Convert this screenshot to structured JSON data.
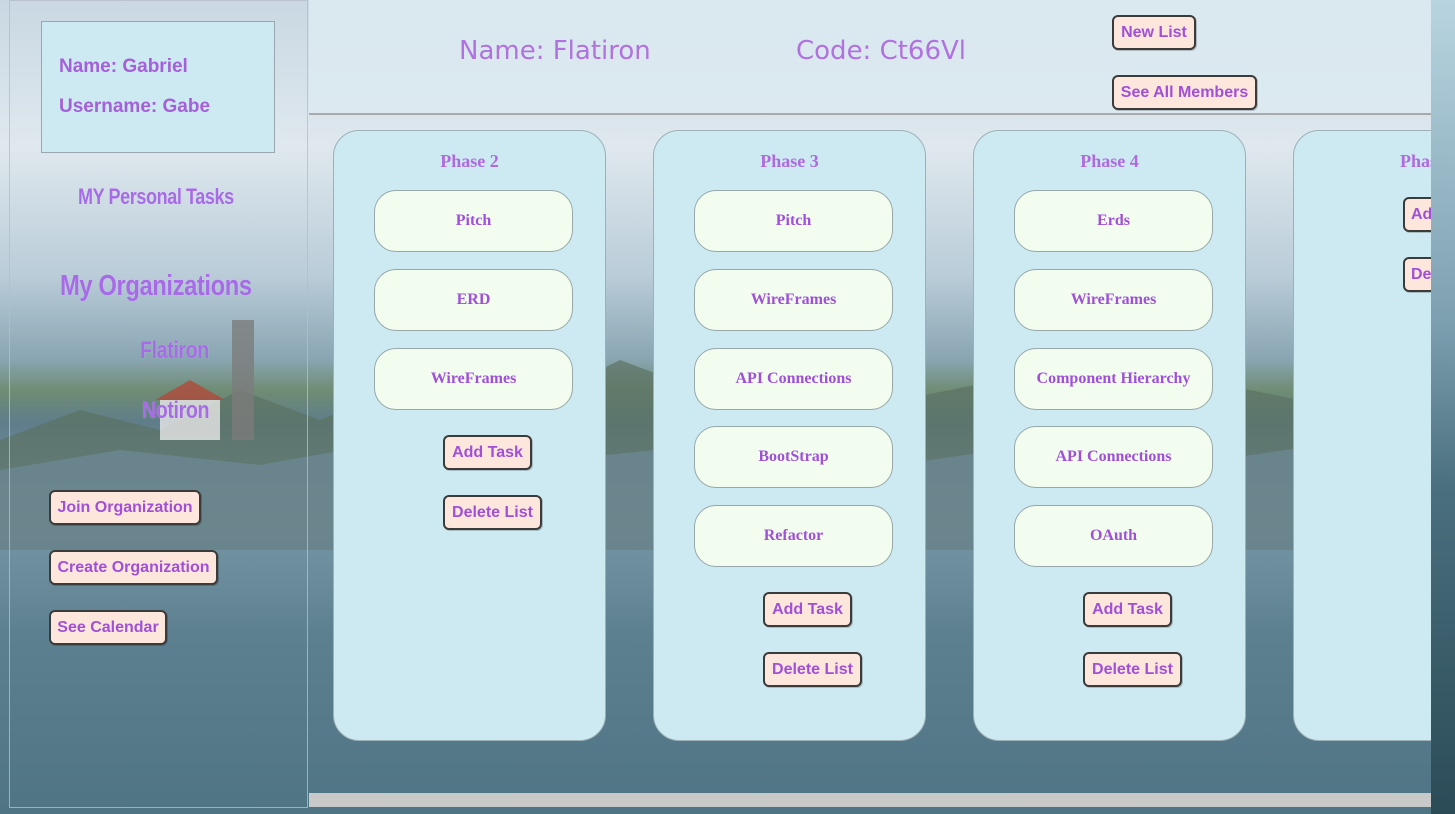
{
  "user": {
    "name_line": "Name: Gabriel",
    "username_line": "Username: Gabe"
  },
  "sidebar": {
    "personal_tasks": "MY Personal Tasks",
    "organizations_heading": "My Organizations",
    "organizations": [
      "Flatiron",
      "Notiron"
    ],
    "join_button": "Join Organization",
    "create_button": "Create Organization",
    "calendar_button": "See Calendar"
  },
  "header": {
    "org_name": "Name: Flatiron",
    "org_code": "Code: Ct66Vl",
    "new_list_button": "New List",
    "see_members_button": "See All Members"
  },
  "lists": [
    {
      "title": "Phase 2",
      "tasks": [
        "Pitch",
        "ERD",
        "WireFrames"
      ],
      "add_task": "Add Task",
      "delete_list": "Delete List"
    },
    {
      "title": "Phase 3",
      "tasks": [
        "Pitch",
        "WireFrames",
        "API Connections",
        "BootStrap",
        "Refactor"
      ],
      "add_task": "Add Task",
      "delete_list": "Delete List"
    },
    {
      "title": "Phase 4",
      "tasks": [
        "Erds",
        "WireFrames",
        "Component Hierarchy",
        "API Connections",
        "OAuth"
      ],
      "add_task": "Add Task",
      "delete_list": "Delete List"
    },
    {
      "title": "Phas",
      "tasks": [],
      "add_task": "Ad",
      "delete_list": "De"
    }
  ],
  "colors": {
    "accent_text": "#a86be8",
    "button_bg": "#fde6dc",
    "card_bg": "#cdeaf3",
    "task_bg": "#f2fdf0"
  }
}
